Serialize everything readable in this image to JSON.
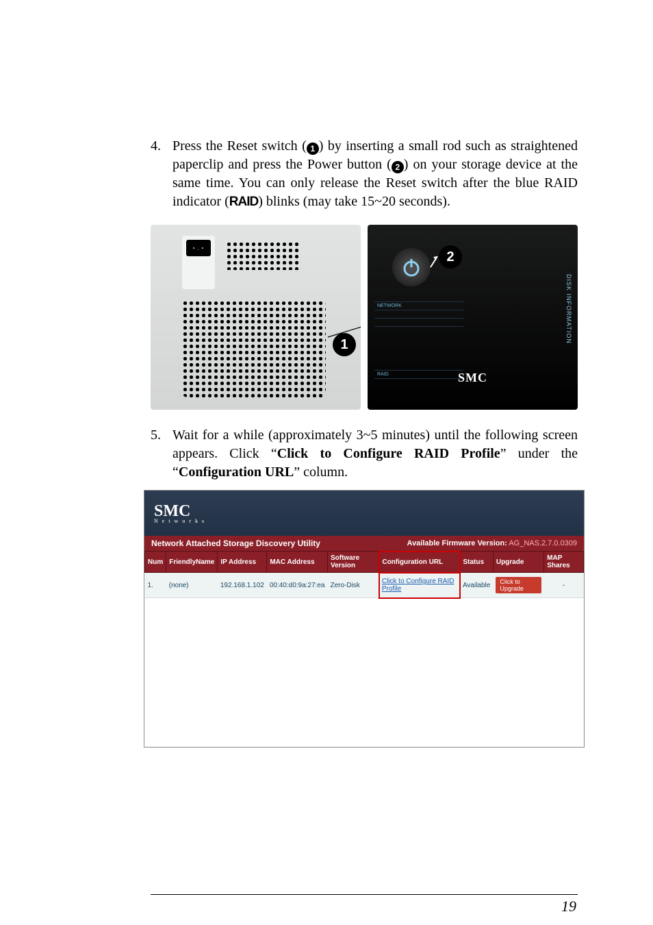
{
  "step4": {
    "num": "4.",
    "body_pre": "Press the Reset switch (",
    "body_mid1": ") by inserting a small rod such as straightened paperclip and press the Power button (",
    "body_mid2": ") on your storage device at the same time. You can only release the Reset switch after the blue RAID indicator (",
    "raid_word": "RAID",
    "body_post": ") blinks (may take 15~20 seconds).",
    "icon1": "1",
    "icon2": "2"
  },
  "fig_left": {
    "badge": "1"
  },
  "fig_right": {
    "badge": "2",
    "sidelabel": "DISK  INFORMATION",
    "logo": "SMC",
    "lblNetwork": "NETWORK",
    "lblRaid": "RAID"
  },
  "step5": {
    "num": "5.",
    "body_pre": "Wait for a while (approximately 3~5 minutes) until the following screen appears. Click “",
    "bold1": "Click to Configure RAID Profile",
    "mid": "” under the “",
    "bold2": "Configuration URL",
    "post": "” column."
  },
  "disc": {
    "brand": "SMC",
    "brand_sub": "N e t w o r k s",
    "title": "Network Attached Storage Discovery Utility",
    "avail_label": "Available Firmware Version:",
    "avail_value": "AG_NAS.2.7.0.0309",
    "th": [
      "Num",
      "FriendlyName",
      "IP Address",
      "MAC Address",
      "Software Version",
      "Configuration URL",
      "Status",
      "Upgrade",
      "MAP Shares"
    ],
    "row": {
      "num": "1.",
      "name": "(none)",
      "ip": "192.168.1.102",
      "mac": "00:40:d0:9a:27:ea",
      "sw": "Zero-Disk",
      "conf": "Click to Configure RAID Profile",
      "status": "Available",
      "upg": "Click to Upgrade",
      "map": "-"
    }
  },
  "page_number": "19"
}
